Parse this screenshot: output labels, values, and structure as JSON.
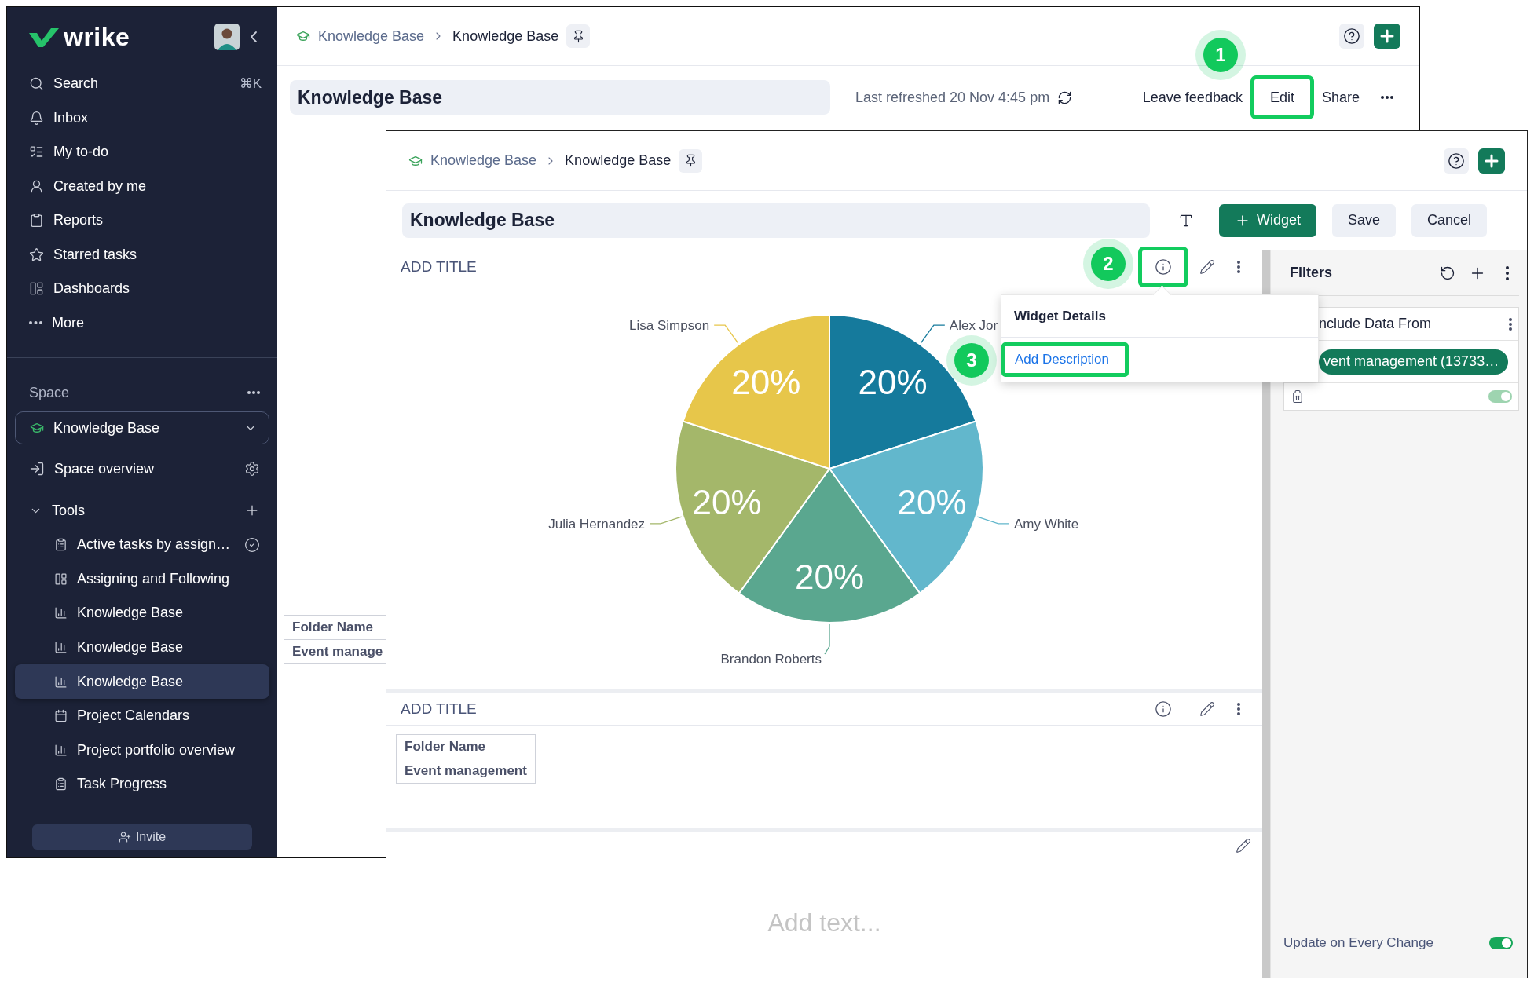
{
  "back_window": {
    "sidebar": {
      "logo": "wrike",
      "nav": [
        {
          "label": "Search",
          "shortcut": "⌘K"
        },
        {
          "label": "Inbox"
        },
        {
          "label": "My to-do"
        },
        {
          "label": "Created by me"
        },
        {
          "label": "Reports"
        },
        {
          "label": "Starred tasks"
        },
        {
          "label": "Dashboards"
        },
        {
          "label": "More"
        }
      ],
      "space": {
        "heading": "Space",
        "selector": "Knowledge Base",
        "overview": "Space overview"
      },
      "tools": {
        "heading": "Tools",
        "expanded": true,
        "items": [
          {
            "label": "Active tasks by assign…",
            "kind": "report",
            "checked": true,
            "selected": false
          },
          {
            "label": "Assigning and Following",
            "kind": "dashboard",
            "checked": false,
            "selected": false
          },
          {
            "label": "Knowledge Base",
            "kind": "chart",
            "checked": false,
            "selected": false
          },
          {
            "label": "Knowledge Base",
            "kind": "chart",
            "checked": false,
            "selected": false
          },
          {
            "label": "Knowledge Base",
            "kind": "chart",
            "checked": false,
            "selected": true
          },
          {
            "label": "Project Calendars",
            "kind": "calendar",
            "checked": false,
            "selected": false
          },
          {
            "label": "Project portfolio overview",
            "kind": "chart",
            "checked": false,
            "selected": false
          },
          {
            "label": "Task Progress",
            "kind": "report",
            "checked": false,
            "selected": false
          }
        ]
      },
      "invite": "Invite"
    },
    "breadcrumb": [
      "Knowledge Base",
      "Knowledge Base"
    ],
    "title": "Knowledge Base",
    "last_refreshed": "Last refreshed 20 Nov 4:45 pm",
    "actions": [
      {
        "label": "Leave feedback",
        "highlighted": false
      },
      {
        "label": "Edit",
        "highlighted": true
      },
      {
        "label": "Share",
        "highlighted": false
      }
    ],
    "table": {
      "header": "Folder Name",
      "rows": [
        "Event manage"
      ]
    }
  },
  "front_window": {
    "breadcrumb": [
      "Knowledge Base",
      "Knowledge Base"
    ],
    "title": "Knowledge Base",
    "buttons": [
      {
        "label": "Widget",
        "kind": "primary"
      },
      {
        "label": "Save",
        "kind": "secondary"
      },
      {
        "label": "Cancel",
        "kind": "secondary"
      }
    ],
    "widgets": [
      {
        "kind": "chart",
        "title": "ADD TITLE",
        "info_highlighted": true,
        "chart_data": {
          "type": "pie",
          "categories": [
            "Alex Jor",
            "Amy White",
            "Brandon Roberts",
            "Julia Hernandez",
            "Lisa Simpson"
          ],
          "values": [
            20,
            20,
            20,
            20,
            20
          ],
          "value_labels": [
            "20%",
            "20%",
            "20%",
            "20%",
            "20%"
          ],
          "colors": [
            "#157a9c",
            "#62b7cc",
            "#5aa78f",
            "#a4b76a",
            "#e7c64a"
          ]
        }
      },
      {
        "kind": "table",
        "title": "ADD TITLE",
        "info_highlighted": false,
        "table": {
          "header": "Folder Name",
          "rows": [
            "Event management"
          ]
        }
      },
      {
        "kind": "text",
        "placeholder": "Add text..."
      }
    ],
    "popup": {
      "title": "Widget Details",
      "link": "Add Description",
      "highlighted": true
    },
    "filters": {
      "title": "Filters",
      "card": {
        "heading": "nclude Data From",
        "chip": "vent management (13733…",
        "toggle_on": true
      },
      "auto_update": {
        "label": "Update on Every Change",
        "on": true
      }
    }
  },
  "callouts": [
    "1",
    "2",
    "3"
  ]
}
